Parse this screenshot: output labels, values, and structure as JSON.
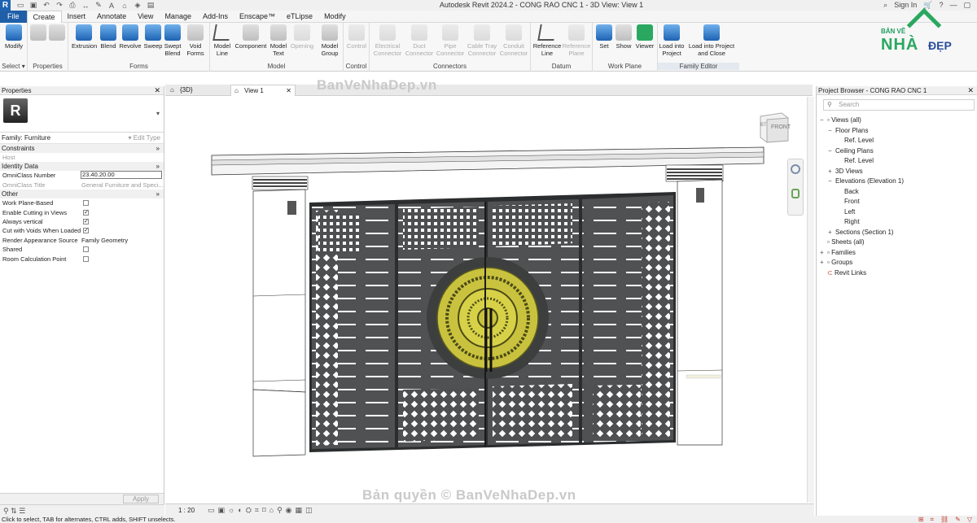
{
  "app": {
    "title": "Autodesk Revit 2024.2 - CONG RAO CNC 1 - 3D View: View 1",
    "sign_in": "Sign In",
    "quick_access_icons": [
      "open-icon",
      "save-icon",
      "undo-icon",
      "redo-icon",
      "print-icon",
      "measure-icon",
      "tag-icon",
      "text-icon",
      "3d-view-icon",
      "section-icon",
      "switch-windows-icon"
    ]
  },
  "ribbon": {
    "tabs": [
      "File",
      "Create",
      "Insert",
      "Annotate",
      "View",
      "Manage",
      "Add-Ins",
      "Enscape™",
      "eTLipse",
      "Modify"
    ],
    "active_tab": "Create",
    "groups": [
      {
        "title": "Select",
        "buttons": [
          "Modify"
        ]
      },
      {
        "title": "Properties",
        "buttons": []
      },
      {
        "title": "Forms",
        "buttons": [
          "Extrusion",
          "Blend",
          "Revolve",
          "Sweep",
          "Swept Blend",
          "Void Forms"
        ]
      },
      {
        "title": "Model",
        "buttons": [
          "Model Line",
          "Component",
          "Model Text",
          "Opening",
          "Model Group"
        ]
      },
      {
        "title": "Control",
        "buttons": [
          "Control"
        ]
      },
      {
        "title": "Connectors",
        "buttons": [
          "Electrical Connector",
          "Duct Connector",
          "Pipe Connector",
          "Cable Tray Connector",
          "Conduit Connector"
        ]
      },
      {
        "title": "Datum",
        "buttons": [
          "Reference Line",
          "Reference Plane"
        ]
      },
      {
        "title": "Work Plane",
        "buttons": [
          "Set",
          "Show",
          "Viewer"
        ]
      },
      {
        "title": "Family Editor",
        "buttons": [
          "Load into Project",
          "Load into Project and Close"
        ]
      }
    ],
    "select_label": "Select ▾"
  },
  "brand": {
    "top": "BẢN VẼ",
    "main": "NHÀ",
    "dep": "ĐẸP"
  },
  "watermarks": {
    "top": "BanVeNhaDep.vn",
    "bottom": "Bản quyền © BanVeNhaDep.vn"
  },
  "properties": {
    "title": "Properties",
    "family_label": "Family: Furniture",
    "edit_type": "Edit Type",
    "sections": [
      {
        "name": "Constraints",
        "rows": [
          {
            "label": "Host",
            "value": "",
            "disabled": true
          }
        ]
      },
      {
        "name": "Identity Data",
        "rows": [
          {
            "label": "OmniClass Number",
            "value": "23.40.20.00",
            "input": true
          },
          {
            "label": "OmniClass Title",
            "value": "General Furniture and Speci...",
            "disabled": true
          }
        ]
      },
      {
        "name": "Other",
        "rows": [
          {
            "label": "Work Plane-Based",
            "check": false
          },
          {
            "label": "Enable Cutting in Views",
            "check": true
          },
          {
            "label": "Always vertical",
            "check": true
          },
          {
            "label": "Cut with Voids When Loaded",
            "check": true
          },
          {
            "label": "Render Appearance Source",
            "value": "Family Geometry"
          },
          {
            "label": "Shared",
            "check": false
          },
          {
            "label": "Room Calculation Point",
            "check": false
          }
        ]
      }
    ],
    "apply": "Apply"
  },
  "view_tabs": [
    {
      "label": "{3D}",
      "active": false
    },
    {
      "label": "View 1",
      "active": true
    }
  ],
  "viewcube": {
    "top": "BT",
    "front": "FRONT"
  },
  "view_control": {
    "scale": "1 : 20"
  },
  "browser": {
    "title": "Project Browser - CONG RAO CNC 1",
    "search_placeholder": "Search",
    "tree": [
      {
        "label": "Views (all)",
        "level": 0,
        "toggle": "−"
      },
      {
        "label": "Floor Plans",
        "level": 1,
        "toggle": "−"
      },
      {
        "label": "Ref. Level",
        "level": 2,
        "toggle": ""
      },
      {
        "label": "Ceiling Plans",
        "level": 1,
        "toggle": "−"
      },
      {
        "label": "Ref. Level",
        "level": 2,
        "toggle": ""
      },
      {
        "label": "3D Views",
        "level": 1,
        "toggle": "+"
      },
      {
        "label": "Elevations (Elevation 1)",
        "level": 1,
        "toggle": "−"
      },
      {
        "label": "Back",
        "level": 2,
        "toggle": ""
      },
      {
        "label": "Front",
        "level": 2,
        "toggle": ""
      },
      {
        "label": "Left",
        "level": 2,
        "toggle": ""
      },
      {
        "label": "Right",
        "level": 2,
        "toggle": ""
      },
      {
        "label": "Sections (Section 1)",
        "level": 1,
        "toggle": "+"
      },
      {
        "label": "Sheets (all)",
        "level": 0,
        "toggle": ""
      },
      {
        "label": "Families",
        "level": 0,
        "toggle": "+"
      },
      {
        "label": "Groups",
        "level": 0,
        "toggle": "+"
      },
      {
        "label": "Revit Links",
        "level": 0,
        "toggle": ""
      }
    ]
  },
  "status": {
    "text": "Click to select, TAB for alternates, CTRL adds, SHIFT unselects."
  }
}
